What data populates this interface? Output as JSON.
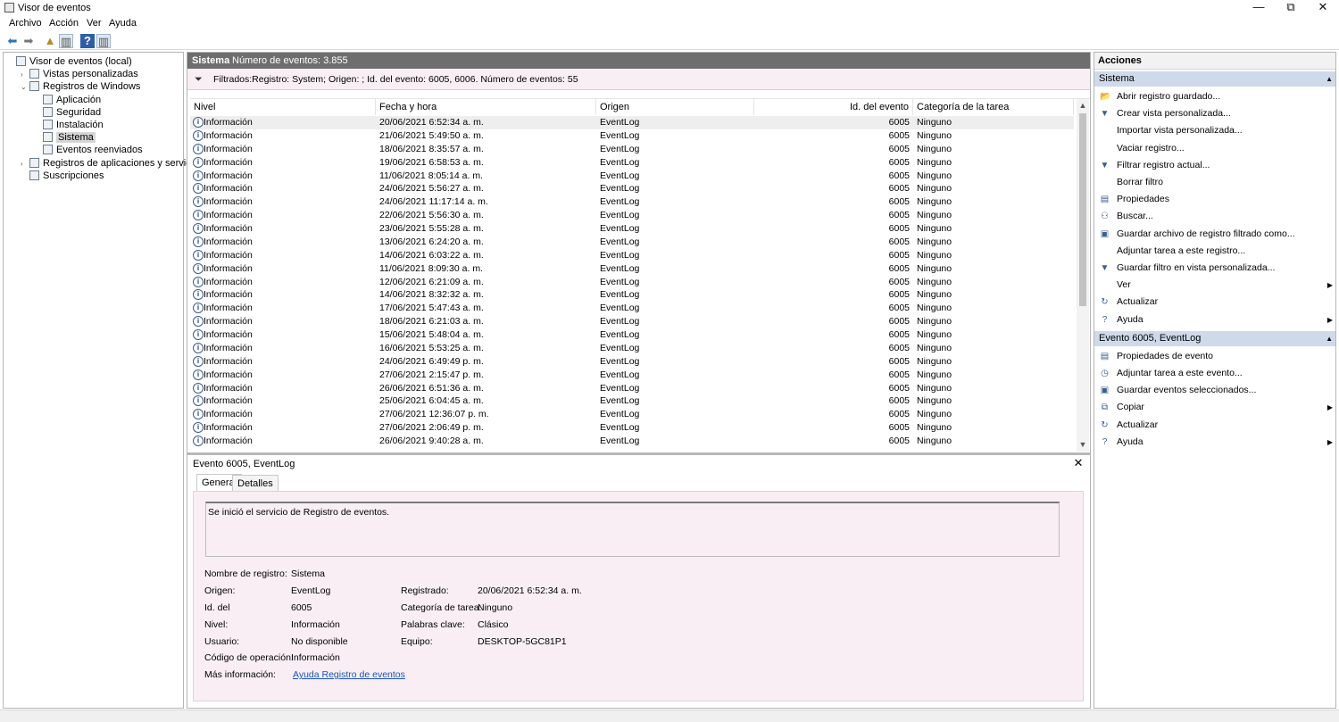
{
  "window": {
    "title": "Visor de eventos",
    "minimize": "—",
    "maximize": "⧉",
    "close": "✕"
  },
  "menu": [
    "Archivo",
    "Acción",
    "Ver",
    "Ayuda"
  ],
  "tree": [
    {
      "label": "Visor de eventos (local)",
      "indent": 0,
      "expander": "",
      "selected": false
    },
    {
      "label": "Vistas personalizadas",
      "indent": 1,
      "expander": "›",
      "selected": false
    },
    {
      "label": "Registros de Windows",
      "indent": 1,
      "expander": "⌄",
      "selected": false
    },
    {
      "label": "Aplicación",
      "indent": 2,
      "expander": "",
      "selected": false
    },
    {
      "label": "Seguridad",
      "indent": 2,
      "expander": "",
      "selected": false
    },
    {
      "label": "Instalación",
      "indent": 2,
      "expander": "",
      "selected": false
    },
    {
      "label": "Sistema",
      "indent": 2,
      "expander": "",
      "selected": true
    },
    {
      "label": "Eventos reenviados",
      "indent": 2,
      "expander": "",
      "selected": false
    },
    {
      "label": "Registros de aplicaciones y servicios",
      "indent": 1,
      "expander": "›",
      "selected": false
    },
    {
      "label": "Suscripciones",
      "indent": 1,
      "expander": "",
      "selected": false
    }
  ],
  "center": {
    "log_name": "Sistema",
    "event_count": "Número de eventos: 3.855",
    "filter_text": "Filtrados:Registro: System; Origen: ; Id. del evento: 6005, 6006. Número de eventos: 55",
    "columns": [
      "Nivel",
      "Fecha y hora",
      "Origen",
      "Id. del evento",
      "Categoría de la tarea"
    ]
  },
  "events": [
    [
      "Información",
      "20/06/2021 6:52:34 a. m.",
      "EventLog",
      "6005",
      "Ninguno"
    ],
    [
      "Información",
      "21/06/2021 5:49:50 a. m.",
      "EventLog",
      "6005",
      "Ninguno"
    ],
    [
      "Información",
      "18/06/2021 8:35:57 a. m.",
      "EventLog",
      "6005",
      "Ninguno"
    ],
    [
      "Información",
      "19/06/2021 6:58:53 a. m.",
      "EventLog",
      "6005",
      "Ninguno"
    ],
    [
      "Información",
      "11/06/2021 8:05:14 a. m.",
      "EventLog",
      "6005",
      "Ninguno"
    ],
    [
      "Información",
      "24/06/2021 5:56:27 a. m.",
      "EventLog",
      "6005",
      "Ninguno"
    ],
    [
      "Información",
      "24/06/2021 11:17:14 a. m.",
      "EventLog",
      "6005",
      "Ninguno"
    ],
    [
      "Información",
      "22/06/2021 5:56:30 a. m.",
      "EventLog",
      "6005",
      "Ninguno"
    ],
    [
      "Información",
      "23/06/2021 5:55:28 a. m.",
      "EventLog",
      "6005",
      "Ninguno"
    ],
    [
      "Información",
      "13/06/2021 6:24:20 a. m.",
      "EventLog",
      "6005",
      "Ninguno"
    ],
    [
      "Información",
      "14/06/2021 6:03:22 a. m.",
      "EventLog",
      "6005",
      "Ninguno"
    ],
    [
      "Información",
      "11/06/2021 8:09:30 a. m.",
      "EventLog",
      "6005",
      "Ninguno"
    ],
    [
      "Información",
      "12/06/2021 6:21:09 a. m.",
      "EventLog",
      "6005",
      "Ninguno"
    ],
    [
      "Información",
      "14/06/2021 8:32:32 a. m.",
      "EventLog",
      "6005",
      "Ninguno"
    ],
    [
      "Información",
      "17/06/2021 5:47:43 a. m.",
      "EventLog",
      "6005",
      "Ninguno"
    ],
    [
      "Información",
      "18/06/2021 6:21:03 a. m.",
      "EventLog",
      "6005",
      "Ninguno"
    ],
    [
      "Información",
      "15/06/2021 5:48:04 a. m.",
      "EventLog",
      "6005",
      "Ninguno"
    ],
    [
      "Información",
      "16/06/2021 5:53:25 a. m.",
      "EventLog",
      "6005",
      "Ninguno"
    ],
    [
      "Información",
      "24/06/2021 6:49:49 p. m.",
      "EventLog",
      "6005",
      "Ninguno"
    ],
    [
      "Información",
      "27/06/2021 2:15:47 p. m.",
      "EventLog",
      "6005",
      "Ninguno"
    ],
    [
      "Información",
      "26/06/2021 6:51:36 a. m.",
      "EventLog",
      "6005",
      "Ninguno"
    ],
    [
      "Información",
      "25/06/2021 6:04:45 a. m.",
      "EventLog",
      "6005",
      "Ninguno"
    ],
    [
      "Información",
      "27/06/2021 12:36:07 p. m.",
      "EventLog",
      "6005",
      "Ninguno"
    ],
    [
      "Información",
      "27/06/2021 2:06:49 p. m.",
      "EventLog",
      "6005",
      "Ninguno"
    ],
    [
      "Información",
      "26/06/2021 9:40:28 a. m.",
      "EventLog",
      "6005",
      "Ninguno"
    ]
  ],
  "detail": {
    "title": "Evento 6005, EventLog",
    "tabs": [
      "General",
      "Detalles"
    ],
    "message": "Se inició el servicio de Registro de eventos.",
    "labels": {
      "log_name": "Nombre de registro:",
      "source": "Origen:",
      "event_id": "Id. del",
      "level": "Nivel:",
      "user": "Usuario:",
      "opcode": "Código de operación:",
      "more_info": "Más información:",
      "logged": "Registrado:",
      "task_category": "Categoría de tarea:",
      "keywords": "Palabras clave:",
      "computer": "Equipo:"
    },
    "values": {
      "log_name": "Sistema",
      "source": "EventLog",
      "event_id": "6005",
      "level": "Información",
      "user": "No disponible",
      "opcode": "Información",
      "more_info": "Ayuda Registro de eventos",
      "logged": "20/06/2021 6:52:34 a. m.",
      "task_category": "Ninguno",
      "keywords": "Clásico",
      "computer": "DESKTOP-5GC81P1"
    }
  },
  "actions": {
    "title": "Acciones",
    "sections": [
      {
        "name": "Sistema",
        "items": [
          {
            "label": "Abrir registro guardado...",
            "icon": "folder-open-icon",
            "glyph": "📂",
            "submenu": false
          },
          {
            "label": "Crear vista personalizada...",
            "icon": "filter-create-icon",
            "glyph": "▼",
            "submenu": false
          },
          {
            "label": "Importar vista personalizada...",
            "icon": "",
            "glyph": "",
            "submenu": false
          },
          {
            "label": "Vaciar registro...",
            "icon": "",
            "glyph": "",
            "submenu": false
          },
          {
            "label": "Filtrar registro actual...",
            "icon": "filter-icon",
            "glyph": "▼",
            "submenu": false
          },
          {
            "label": "Borrar filtro",
            "icon": "",
            "glyph": "",
            "submenu": false
          },
          {
            "label": "Propiedades",
            "icon": "properties-icon",
            "glyph": "▤",
            "submenu": false
          },
          {
            "label": "Buscar...",
            "icon": "binoculars-icon",
            "glyph": "⚇",
            "submenu": false
          },
          {
            "label": "Guardar archivo de registro filtrado como...",
            "icon": "save-icon",
            "glyph": "▣",
            "submenu": false
          },
          {
            "label": "Adjuntar tarea a este registro...",
            "icon": "",
            "glyph": "",
            "submenu": false
          },
          {
            "label": "Guardar filtro en vista personalizada...",
            "icon": "save-filter-icon",
            "glyph": "▼",
            "submenu": false
          },
          {
            "label": "Ver",
            "icon": "",
            "glyph": "",
            "submenu": true
          },
          {
            "label": "Actualizar",
            "icon": "refresh-icon",
            "glyph": "↻",
            "submenu": false
          },
          {
            "label": "Ayuda",
            "icon": "help-icon",
            "glyph": "?",
            "submenu": true
          }
        ]
      },
      {
        "name": "Evento 6005, EventLog",
        "items": [
          {
            "label": "Propiedades de evento",
            "icon": "event-properties-icon",
            "glyph": "▤",
            "submenu": false
          },
          {
            "label": "Adjuntar tarea a este evento...",
            "icon": "attach-task-icon",
            "glyph": "◷",
            "submenu": false
          },
          {
            "label": "Guardar eventos seleccionados...",
            "icon": "save-icon",
            "glyph": "▣",
            "submenu": false
          },
          {
            "label": "Copiar",
            "icon": "copy-icon",
            "glyph": "⧉",
            "submenu": true
          },
          {
            "label": "Actualizar",
            "icon": "refresh-icon",
            "glyph": "↻",
            "submenu": false
          },
          {
            "label": "Ayuda",
            "icon": "help-icon",
            "glyph": "?",
            "submenu": true
          }
        ]
      }
    ]
  }
}
